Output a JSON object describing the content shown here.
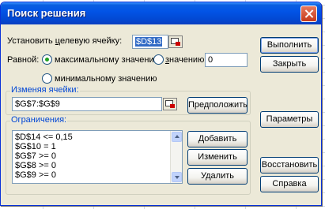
{
  "dialog": {
    "title": "Поиск решения"
  },
  "target": {
    "label_pre": "Установить ",
    "label_u": "ц",
    "label_post": "елевую ячейку:",
    "value": "$D$13"
  },
  "equal": {
    "label": "Равной:",
    "max_label": "максимальному значению",
    "value_pre": "з",
    "value_post": "начению:",
    "value": "0",
    "min_label": "минимальному значению"
  },
  "changing": {
    "title": "Изменяя ячейки:",
    "value": "$G$7:$G$9",
    "guess_button": "Предположить"
  },
  "constraints": {
    "title": "Ограничения:",
    "items": [
      "$D$14 <= 0,15",
      "$G$10 = 1",
      "$G$7 >= 0",
      "$G$8 >= 0",
      "$G$9 >= 0"
    ],
    "add_button": "Добавить",
    "change_button": "Изменить",
    "delete_button": "Удалить"
  },
  "buttons": {
    "run": "Выполнить",
    "close": "Закрыть",
    "options": "Параметры",
    "reset": "Восстановить",
    "help": "Справка"
  },
  "colors": {
    "title_bar": "#0254e6",
    "dialog_bg": "#ece9d8",
    "group_title": "#0046d5",
    "selection": "#316ac5"
  }
}
